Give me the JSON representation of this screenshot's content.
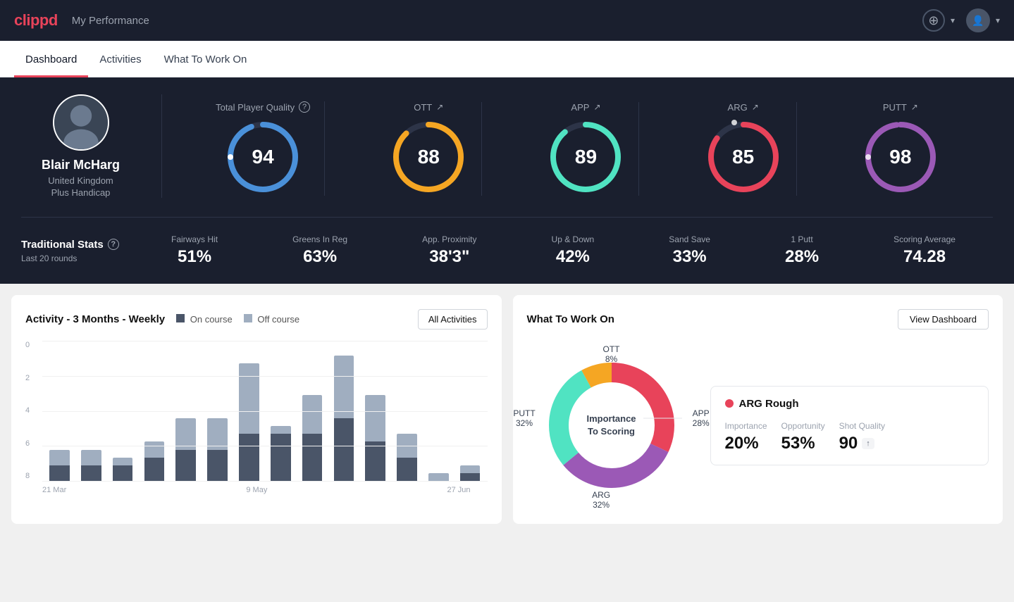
{
  "app": {
    "logo": "clippd",
    "title": "My Performance"
  },
  "tabs": [
    {
      "id": "dashboard",
      "label": "Dashboard",
      "active": true
    },
    {
      "id": "activities",
      "label": "Activities",
      "active": false
    },
    {
      "id": "what-to-work-on",
      "label": "What To Work On",
      "active": false
    }
  ],
  "player": {
    "name": "Blair McHarg",
    "country": "United Kingdom",
    "handicap": "Plus Handicap",
    "avatar_initial": "🧍"
  },
  "total_quality": {
    "label": "Total Player Quality",
    "value": 94,
    "color": "#4a90d9",
    "percent": 94
  },
  "metrics": [
    {
      "id": "ott",
      "label": "OTT",
      "value": 88,
      "color": "#f5a623",
      "percent": 88,
      "trend": "↗"
    },
    {
      "id": "app",
      "label": "APP",
      "value": 89,
      "color": "#50e3c2",
      "percent": 89,
      "trend": "↗"
    },
    {
      "id": "arg",
      "label": "ARG",
      "value": 85,
      "color": "#e8435a",
      "percent": 85,
      "trend": "↗"
    },
    {
      "id": "putt",
      "label": "PUTT",
      "value": 98,
      "color": "#9b59b6",
      "percent": 98,
      "trend": "↗"
    }
  ],
  "trad_stats": {
    "title": "Traditional Stats",
    "subtitle": "Last 20 rounds",
    "items": [
      {
        "label": "Fairways Hit",
        "value": "51%"
      },
      {
        "label": "Greens In Reg",
        "value": "63%"
      },
      {
        "label": "App. Proximity",
        "value": "38'3\""
      },
      {
        "label": "Up & Down",
        "value": "42%"
      },
      {
        "label": "Sand Save",
        "value": "33%"
      },
      {
        "label": "1 Putt",
        "value": "28%"
      },
      {
        "label": "Scoring Average",
        "value": "74.28"
      }
    ]
  },
  "activity_chart": {
    "title": "Activity - 3 Months - Weekly",
    "legend": [
      {
        "label": "On course",
        "color": "#4a5568"
      },
      {
        "label": "Off course",
        "color": "#a0aec0"
      }
    ],
    "button": "All Activities",
    "x_labels": [
      "21 Mar",
      "9 May",
      "27 Jun"
    ],
    "y_labels": [
      "0",
      "2",
      "4",
      "6",
      "8"
    ],
    "bars": [
      {
        "on": 1,
        "off": 1
      },
      {
        "on": 1,
        "off": 1
      },
      {
        "on": 1,
        "off": 0.5
      },
      {
        "on": 1.5,
        "off": 1
      },
      {
        "on": 2,
        "off": 2
      },
      {
        "on": 2,
        "off": 2
      },
      {
        "on": 3,
        "off": 4.5
      },
      {
        "on": 3,
        "off": 0.5
      },
      {
        "on": 3,
        "off": 2.5
      },
      {
        "on": 4,
        "off": 4
      },
      {
        "on": 2.5,
        "off": 3
      },
      {
        "on": 1.5,
        "off": 1.5
      },
      {
        "on": 0,
        "off": 0.5
      },
      {
        "on": 0.5,
        "off": 0.5
      }
    ]
  },
  "what_to_work_on": {
    "title": "What To Work On",
    "button": "View Dashboard",
    "donut_center": "Importance\nTo Scoring",
    "segments": [
      {
        "label": "OTT",
        "value": "8%",
        "color": "#f5a623",
        "pos": {
          "top": "8%",
          "left": "50%"
        }
      },
      {
        "label": "APP",
        "value": "28%",
        "color": "#50e3c2",
        "pos": {
          "top": "42%",
          "right": "2%"
        }
      },
      {
        "label": "ARG",
        "value": "32%",
        "color": "#e8435a",
        "pos": {
          "bottom": "6%",
          "left": "44%"
        }
      },
      {
        "label": "PUTT",
        "value": "32%",
        "color": "#9b59b6",
        "pos": {
          "top": "42%",
          "left": "2%"
        }
      }
    ],
    "card": {
      "title": "ARG Rough",
      "dot_color": "#e8435a",
      "metrics": [
        {
          "label": "Importance",
          "value": "20%"
        },
        {
          "label": "Opportunity",
          "value": "53%"
        },
        {
          "label": "Shot Quality",
          "value": "90",
          "badge": "↑"
        }
      ]
    }
  }
}
